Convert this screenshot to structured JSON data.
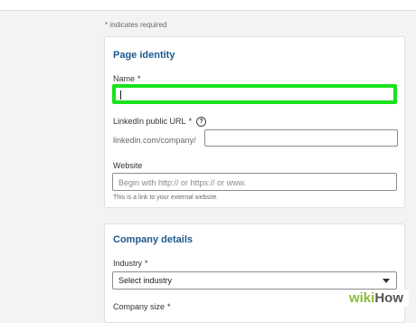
{
  "required_note": "* indicates required",
  "page_identity": {
    "title": "Page identity",
    "name_label": "Name",
    "name_required": "*",
    "name_value": "",
    "url_label": "LinkedIn public URL",
    "url_required": "*",
    "url_help_icon": "?",
    "url_prefix": "linkedin.com/company/",
    "url_value": "",
    "website_label": "Website",
    "website_placeholder": "Begin with http:// or https:// or www.",
    "website_hint": "This is a link to your external website."
  },
  "company_details": {
    "title": "Company details",
    "industry_label": "Industry",
    "industry_required": "*",
    "industry_selected": "Select industry",
    "size_label": "Company size",
    "size_required": "*"
  },
  "watermark": {
    "wiki": "wiki",
    "how": "How"
  },
  "colors": {
    "highlight": "#18e21b",
    "section_title": "#1d5a8e"
  }
}
